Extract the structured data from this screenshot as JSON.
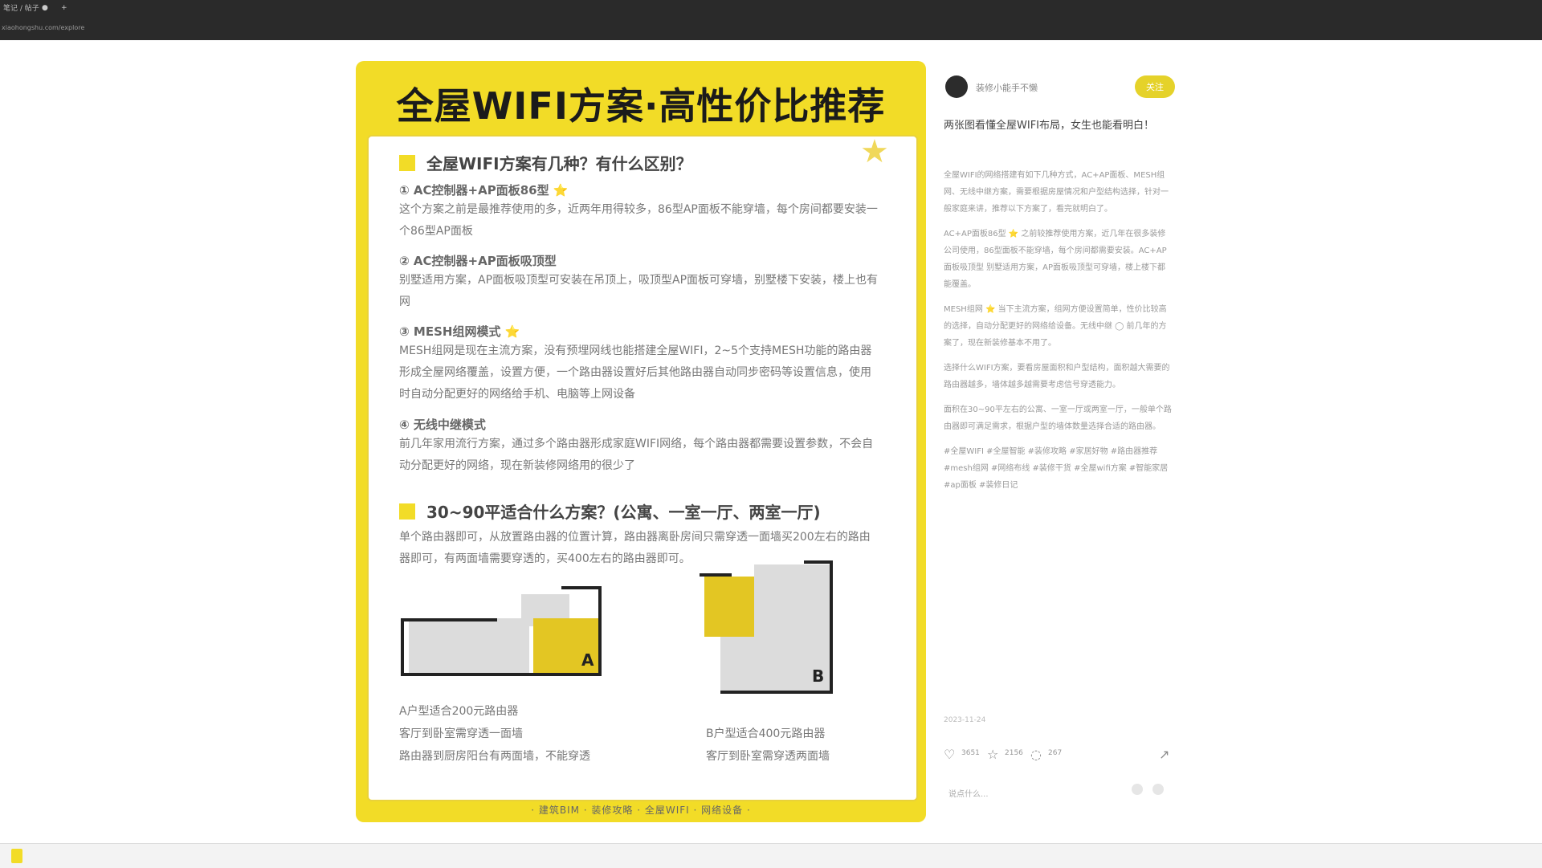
{
  "browser": {
    "tab_title": "笔记 / 帖子",
    "url": "xiaohongshu.com/explore"
  },
  "post_image": {
    "title": "全屋WIFI方案·高性价比推荐",
    "section1_heading": "全屋WIFI方案有几种？有什么区别？",
    "items": [
      {
        "heading": "① AC控制器+AP面板86型 ⭐",
        "text": "这个方案之前是最推荐使用的多，近两年用得较多，86型AP面板不能穿墙，每个房间都要安装一个86型AP面板"
      },
      {
        "heading": "② AC控制器+AP面板吸顶型",
        "text": "别墅适用方案，AP面板吸顶型可安装在吊顶上，吸顶型AP面板可穿墙，别墅楼下安装，楼上也有网"
      },
      {
        "heading": "③ MESH组网模式 ⭐",
        "text": "MESH组网是现在主流方案，没有预埋网线也能搭建全屋WIFI，2~5个支持MESH功能的路由器形成全屋网络覆盖，设置方便，一个路由器设置好后其他路由器自动同步密码等设置信息，使用时自动分配更好的网络给手机、电脑等上网设备"
      },
      {
        "heading": "④ 无线中继模式",
        "text": "前几年家用流行方案，通过多个路由器形成家庭WIFI网络，每个路由器都需要设置参数，不会自动分配更好的网络，现在新装修网络用的很少了"
      }
    ],
    "section2_heading": "30~90平适合什么方案？(公寓、一室一厅、两室一厅)",
    "section2_text": "单个路由器即可，从放置路由器的位置计算，路由器离卧房间只需穿透一面墙买200左右的路由器即可，有两面墙需要穿透的，买400左右的路由器即可。",
    "plan_a_label": "A",
    "plan_b_label": "B",
    "caption_a": [
      "A户型适合200元路由器",
      "客厅到卧室需穿透一面墙",
      "路由器到厨房阳台有两面墙，不能穿透"
    ],
    "caption_b": [
      "B户型适合400元路由器",
      "客厅到卧室需穿透两面墙"
    ],
    "footer": "· 建筑BIM · 装修攻略 · 全屋WIFI · 网络设备 ·"
  },
  "sidebar": {
    "author": "装修小能手不懒",
    "follow_label": "关注",
    "note_title": "两张图看懂全屋WIFI布局，女生也能看明白！",
    "body_paragraphs": [
      "全屋WIFI的网络搭建有如下几种方式，AC+AP面板、MESH组网、无线中继方案，需要根据房屋情况和户型结构选择，针对一般家庭来讲，推荐以下方案了，看完就明白了。",
      "AC+AP面板86型 ⭐ 之前较推荐使用方案，近几年在很多装修公司使用，86型面板不能穿墙，每个房间都需要安装。AC+AP面板吸顶型 别墅适用方案，AP面板吸顶型可穿墙，楼上楼下都能覆盖。",
      "MESH组网 ⭐ 当下主流方案，组网方便设置简单，性价比较高的选择，自动分配更好的网络给设备。无线中继 ◯ 前几年的方案了，现在新装修基本不用了。",
      "选择什么WIFI方案，要看房屋面积和户型结构，面积越大需要的路由器越多，墙体越多越需要考虑信号穿透能力。",
      "面积在30~90平左右的公寓、一室一厅或两室一厅，一般单个路由器即可满足需求，根据户型的墙体数量选择合适的路由器。",
      "#全屋WIFI #全屋智能 #装修攻略 #家居好物 #路由器推荐 #mesh组网 #网络布线 #装修干货 #全屋wifi方案 #智能家居 #ap面板 #装修日记"
    ],
    "date": "2023-11-24",
    "likes": "3651",
    "collects": "2156",
    "comments": "267",
    "comment_placeholder": "说点什么..."
  }
}
